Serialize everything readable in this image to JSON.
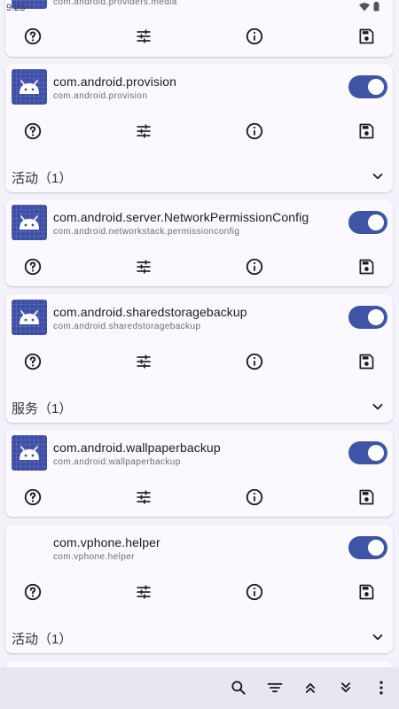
{
  "status": {
    "time": "9:23"
  },
  "cards": [
    {
      "id": "media",
      "package": "com.android.providers.media",
      "enabled": true
    },
    {
      "id": "provision",
      "name": "com.android.provision",
      "package": "com.android.provision",
      "enabled": true,
      "section": "活动（1）"
    },
    {
      "id": "networkpermission",
      "name": "com.android.server.NetworkPermissionConfig",
      "package": "com.android.networkstack.permissionconfig",
      "enabled": true
    },
    {
      "id": "sharedstorage",
      "name": "com.android.sharedstoragebackup",
      "package": "com.android.sharedstoragebackup",
      "enabled": true,
      "section": "服务（1）"
    },
    {
      "id": "wallpaper",
      "name": "com.android.wallpaperbackup",
      "package": "com.android.wallpaperbackup",
      "enabled": true
    },
    {
      "id": "vphone",
      "name": "com.vphone.helper",
      "package": "com.vphone.helper",
      "enabled": true,
      "section": "活动（1）"
    }
  ],
  "icons": {
    "app": "android-icon",
    "help": "help-icon",
    "tune": "tune-icon",
    "info": "info-icon",
    "save": "save-icon",
    "chevron": "chevron-down-icon"
  },
  "bottom_bar": [
    "search-icon",
    "filter-icon",
    "scroll-top-icon",
    "scroll-bottom-icon",
    "more-vert-icon"
  ],
  "colors": {
    "accent": "#3e55a6",
    "background": "#f4f2f9",
    "card": "#fbf9ff"
  }
}
